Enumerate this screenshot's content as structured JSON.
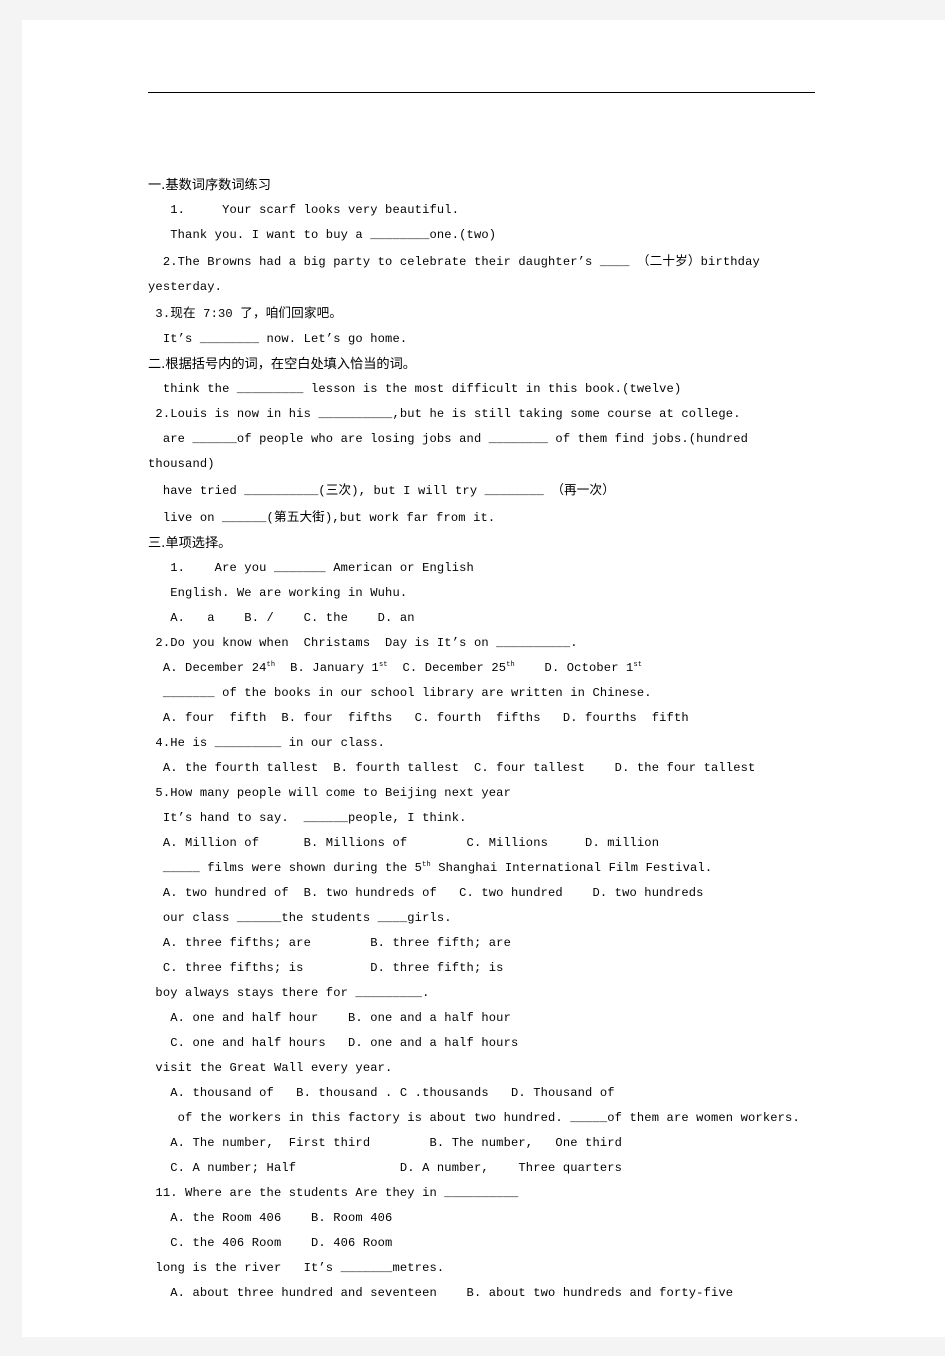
{
  "document": {
    "header_rule": true,
    "sections": [
      {
        "id": "section-1",
        "heading": "一.基数词序数词练习",
        "lines": [
          "   1.     Your scarf looks very beautiful.",
          "   Thank you. I want to buy a ________one.(two)",
          "  2.The Browns had a big party to celebrate their daughter’s ____ （二十岁）birthday",
          "yesterday.",
          " 3.现在 7:30 了，咱们回家吧。",
          "  It’s ________ now. Let’s go home."
        ]
      },
      {
        "id": "section-2",
        "heading": "二.根据括号内的词，在空白处填入恰当的词。",
        "lines": [
          "  think the _________ lesson is the most difficult in this book.(twelve)",
          " 2.Louis is now in his __________,but he is still taking some course at college.",
          "  are ______of people who are losing jobs and ________ of them find jobs.(hundred   thousand)",
          "  have tried __________(三次), but I will try ________ （再一次）",
          "  live on ______(第五大街),but work far from it."
        ]
      },
      {
        "id": "section-3",
        "heading": "三.单项选择。",
        "lines": [
          "   1.    Are you _______ American or English",
          "   English. We are working in Wuhu.",
          "   A.   a    B. /    C. the    D. an",
          " 2.Do you know when  Christams  Day is It’s on __________.",
          "  A. December 24{th}  B. January 1{st}  C. December 25{th}    D. October 1{st}",
          "  _______ of the books in our school library are written in Chinese.",
          "  A. four  fifth  B. four  fifths   C. fourth  fifths   D. fourths  fifth",
          " 4.He is _________ in our class.",
          "  A. the fourth tallest  B. fourth tallest  C. four tallest    D. the four tallest",
          " 5.How many people will come to Beijing next year",
          "  It’s hand to say.  ______people, I think.",
          "  A. Million of      B. Millions of        C. Millions     D. million",
          "  _____ films were shown during the 5{th} Shanghai International Film Festival.",
          "  A. two hundred of  B. two hundreds of   C. two hundred    D. two hundreds",
          "  our class ______the students ____girls.",
          "  A. three fifths; are        B. three fifth; are",
          "  C. three fifths; is         D. three fifth; is",
          " boy always stays there for _________.",
          "   A. one and half hour    B. one and a half hour",
          "   C. one and half hours   D. one and a half hours",
          " visit the Great Wall every year.",
          "   A. thousand of   B. thousand . C .thousands   D. Thousand of",
          "    of the workers in this factory is about two hundred. _____of them are women workers.",
          "   A. The number,  First third        B. The number,   One third",
          "   C. A number; Half              D. A number,    Three quarters",
          " 11. Where are the students Are they in __________",
          "   A. the Room 406    B. Room 406",
          "   C. the 406 Room    D. 406 Room",
          " long is the river   It’s _______metres.",
          "   A. about three hundred and seventeen    B. about two hundreds and forty-five"
        ]
      }
    ]
  }
}
